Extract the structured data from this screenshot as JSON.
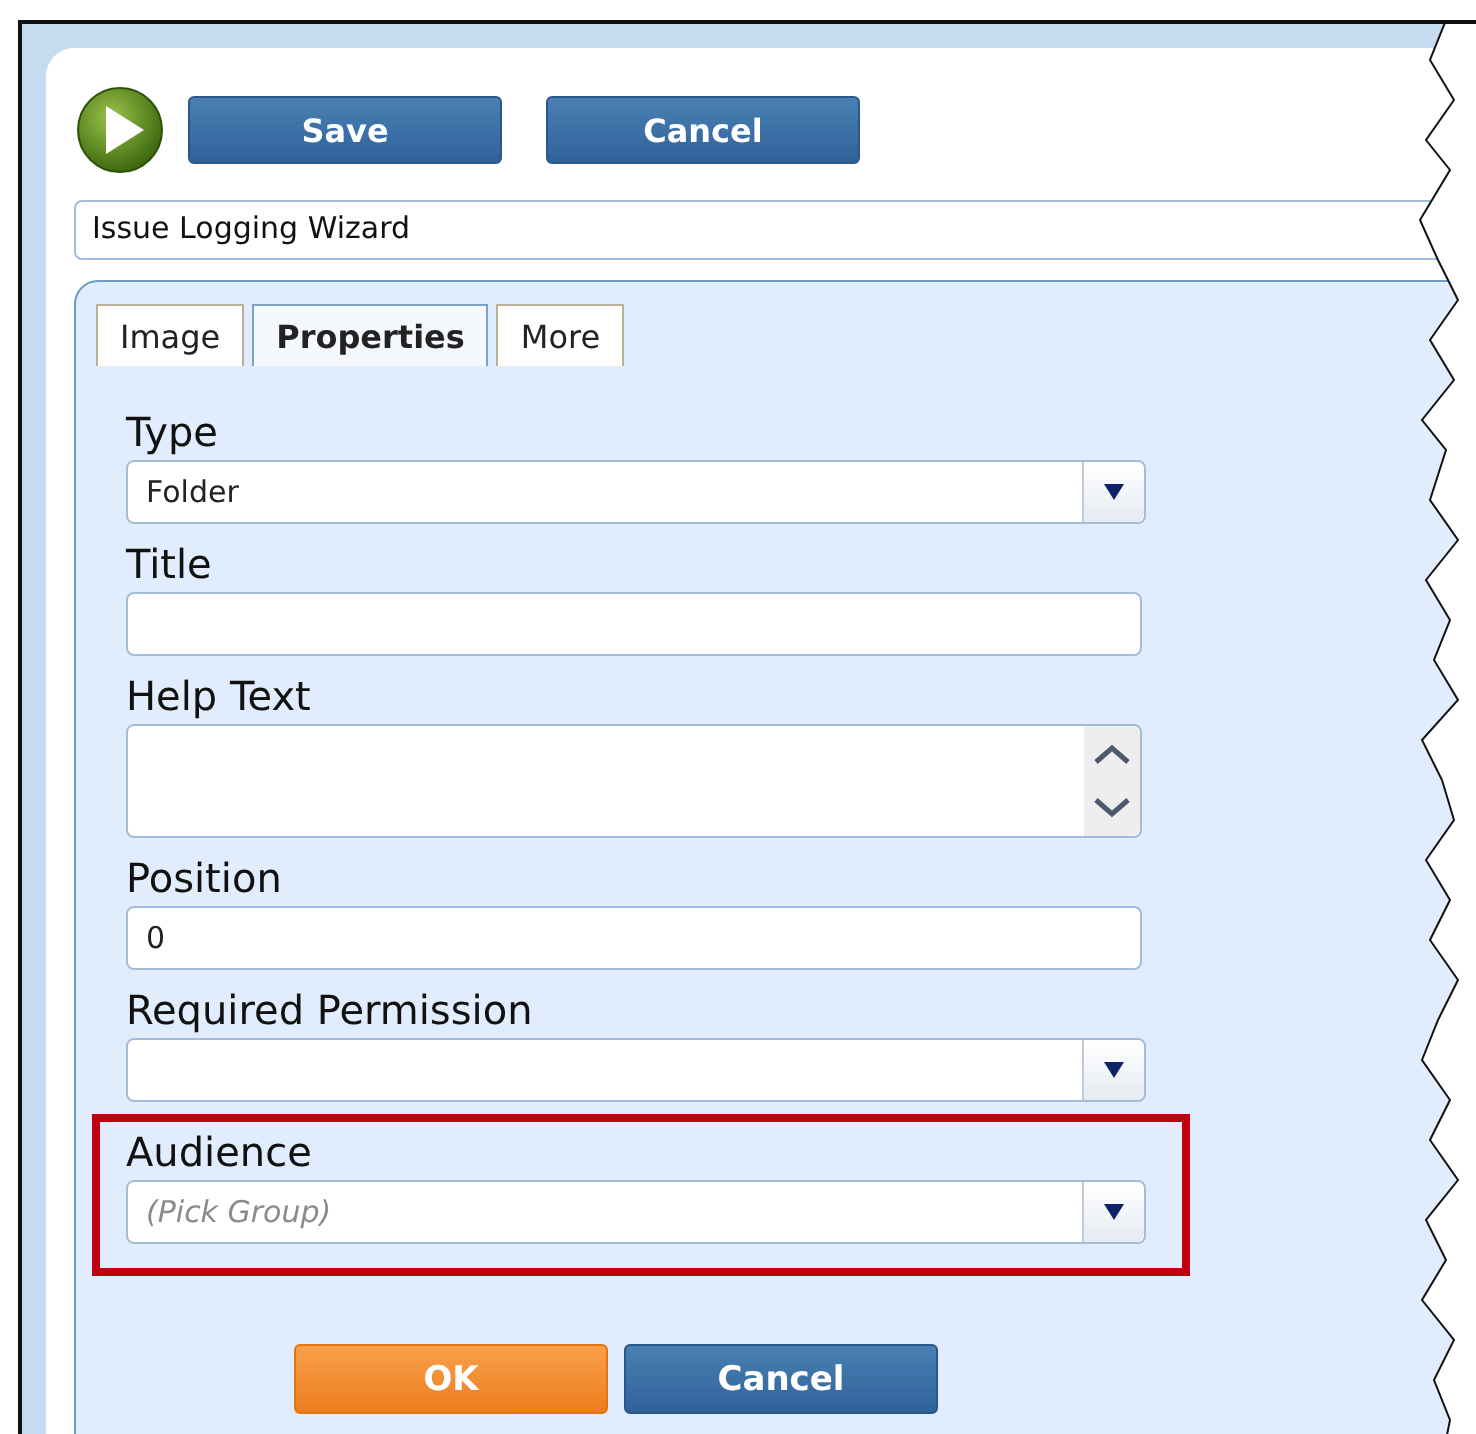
{
  "toolbar": {
    "buttons": [
      "Save",
      "Cancel"
    ]
  },
  "name_field": {
    "value": "Issue Logging Wizard"
  },
  "tabs": [
    {
      "label": "Image",
      "selected": false
    },
    {
      "label": "Properties",
      "selected": true
    },
    {
      "label": "More",
      "selected": false
    }
  ],
  "fields": [
    {
      "label": "Type",
      "kind": "select",
      "value": "Folder",
      "highlighted": false
    },
    {
      "label": "Title",
      "kind": "text",
      "highlighted": false
    },
    {
      "label": "Help Text",
      "kind": "textarea",
      "highlighted": false
    },
    {
      "label": "Position",
      "kind": "text",
      "value": "0",
      "highlighted": false
    },
    {
      "label": "Required Permission",
      "kind": "select",
      "highlighted": false
    },
    {
      "label": "Audience",
      "kind": "select",
      "placeholder": "(Pick Group)",
      "highlighted": true
    }
  ],
  "footer_buttons": [
    {
      "label": "OK",
      "kind": "primary"
    },
    {
      "label": "Cancel",
      "kind": "secondary"
    }
  ]
}
